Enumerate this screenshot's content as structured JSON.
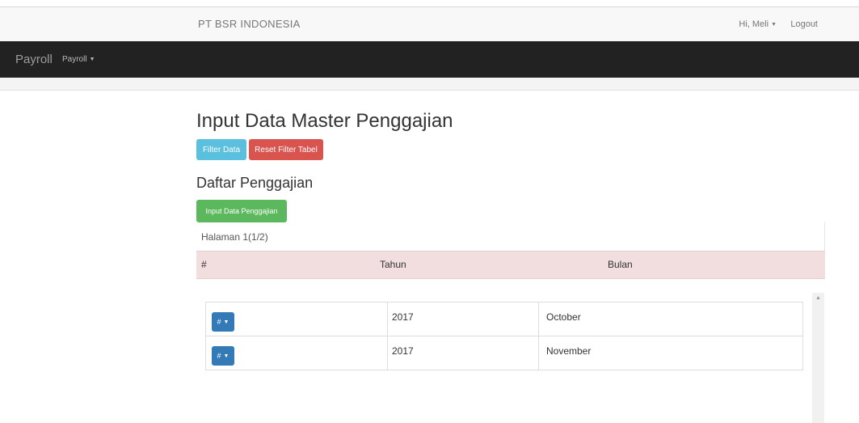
{
  "header": {
    "company": "PT BSR INDONESIA",
    "user_greeting": "Hi, Meli",
    "logout": "Logout"
  },
  "navbar": {
    "brand": "Payroll",
    "menu_label": "Payroll"
  },
  "page": {
    "title": "Input Data Master Penggajian",
    "filter_button": "Filter Data",
    "reset_button": "Reset Filter Tabel",
    "subtitle": "Daftar Penggajian",
    "input_button": "Input Data Penggajian",
    "pagination": "Halaman 1(1/2)"
  },
  "table": {
    "columns": [
      "#",
      "Tahun",
      "Bulan"
    ],
    "rows": [
      {
        "action": "#",
        "year": "2017",
        "month": "October"
      },
      {
        "action": "#",
        "year": "2017",
        "month": "November"
      }
    ]
  },
  "colors": {
    "navbar": "#222222",
    "filter": "#5bc0de",
    "reset": "#d9534f",
    "input": "#5cb85c",
    "action": "#337ab7",
    "header_row": "#f2dede"
  },
  "icons": {
    "caret": "caret-down-icon",
    "scroll_up": "scroll-up-arrow-icon"
  }
}
